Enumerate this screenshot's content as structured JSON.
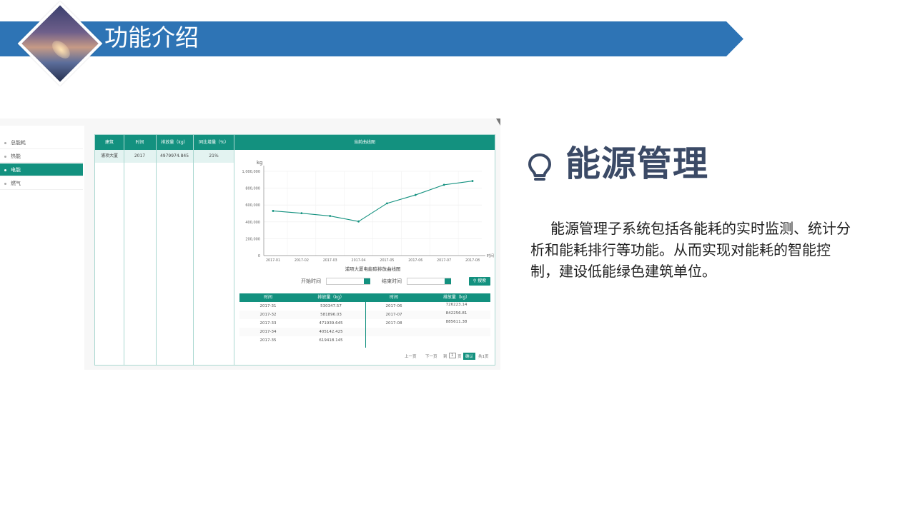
{
  "header": {
    "title": "功能介绍",
    "banner_color": "#2e74b5"
  },
  "sidebar": {
    "items": [
      {
        "label": "总能耗",
        "active": false
      },
      {
        "label": "热能",
        "active": false
      },
      {
        "label": "电能",
        "active": true
      },
      {
        "label": "燃气",
        "active": false
      }
    ]
  },
  "table": {
    "headers": [
      "建筑",
      "时间",
      "排放量（kg）",
      "同比增量（%）"
    ],
    "row": [
      "浦项大厦",
      "2017",
      "4979974.845",
      "21%"
    ]
  },
  "chart_panel_title": "当前曲线图",
  "chart_data": {
    "type": "line",
    "title": "浦项大厦电能碳排放曲线图",
    "ylabel": "kg",
    "xlabel": "时间",
    "categories": [
      "2017-01",
      "2017-02",
      "2017-03",
      "2017-04",
      "2017-05",
      "2017-06",
      "2017-07",
      "2017-08"
    ],
    "values": [
      530000,
      503000,
      470000,
      405000,
      620000,
      720000,
      840000,
      885000
    ],
    "ylim": [
      0,
      1000000
    ],
    "yticks": [
      "0",
      "200,000",
      "400,000",
      "600,000",
      "800,000",
      "1,000,000"
    ],
    "grid": true,
    "line_color": "#13917f"
  },
  "search": {
    "start_label": "开始时间",
    "end_label": "结束时间",
    "button_label": "搜索"
  },
  "detail_table": {
    "headers": [
      "时间",
      "排放量（kg）",
      "时间",
      "排放量（kg）"
    ],
    "left_rows": [
      [
        "2017-31",
        "530347.57"
      ],
      [
        "2017-32",
        "581896.03"
      ],
      [
        "2017-33",
        "471939.645"
      ],
      [
        "2017-34",
        "405142.425"
      ],
      [
        "2017-35",
        "619418.145"
      ]
    ],
    "right_rows": [
      [
        "2017-06",
        "726223.14"
      ],
      [
        "2017-07",
        "842256.81"
      ],
      [
        "2017-08",
        "885611.38"
      ]
    ]
  },
  "pager": {
    "prev": "上一页",
    "next": "下一页",
    "go_prefix": "到",
    "page": "1",
    "go_suffix": "页",
    "confirm": "确认",
    "total": "共1页"
  },
  "section": {
    "heading": "能源管理",
    "description": "能源管理子系统包括各能耗的实时监测、统计分析和能耗排行等功能。从而实现对能耗的智能控制，建设低能绿色建筑单位。"
  }
}
